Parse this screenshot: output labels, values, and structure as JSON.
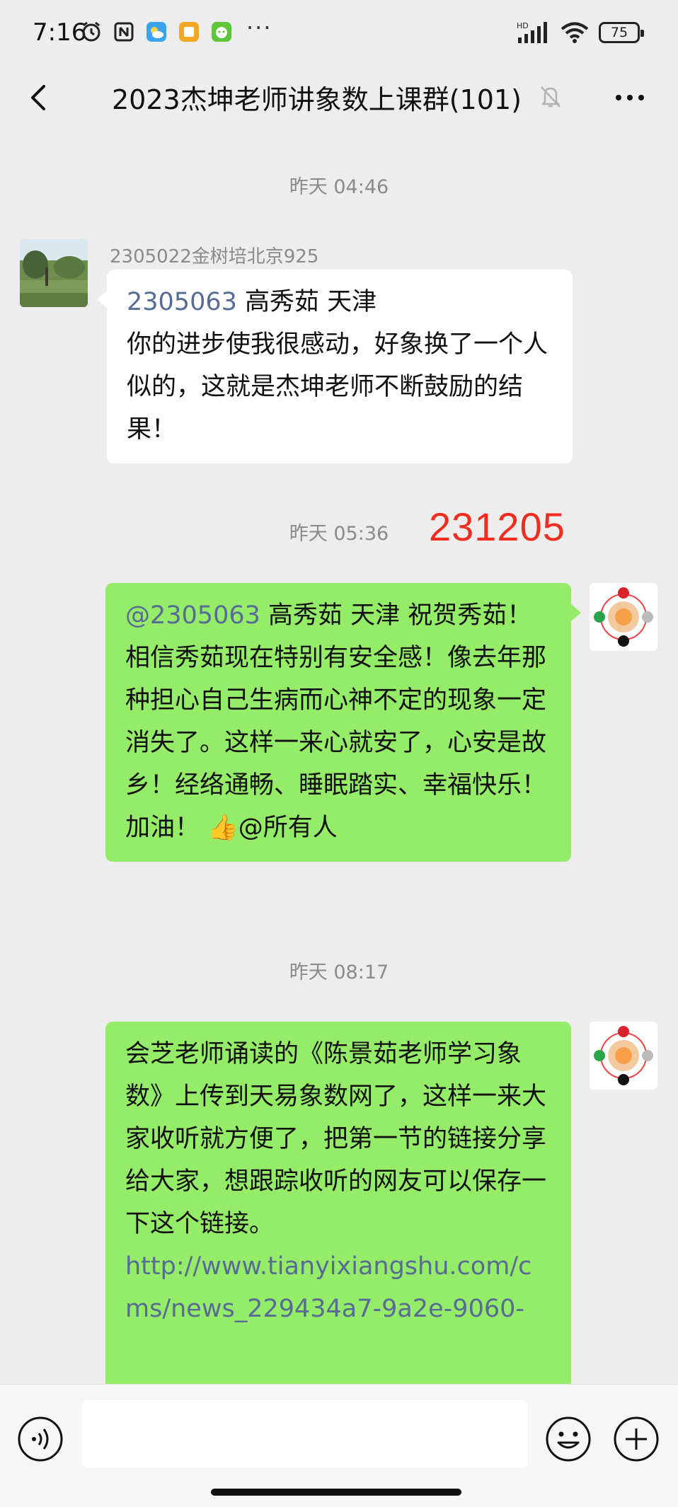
{
  "status_bar": {
    "time": "7:16",
    "dots": "···",
    "network": "HD",
    "battery": "75"
  },
  "header": {
    "title": "2023杰坤老师讲象数上课群(101)"
  },
  "messages": [
    {
      "timestamp": "昨天 04:46"
    },
    {
      "sender": "2305022金树培北京925",
      "mention": "2305063",
      "head": " 高秀茹  天津",
      "body": "你的进步使我很感动，好象换了一个人似的，这就是杰坤老师不断鼓励的结果！"
    },
    {
      "timestamp": "昨天 05:36",
      "annotation": "231205"
    },
    {
      "mention": "@2305063",
      "body": "  高秀茹  天津  祝贺秀茹！相信秀茹现在特别有安全感！像去年那种担心自己生病而心神不定的现象一定消失了。这样一来心就安了，心安是故乡！经络通畅、睡眠踏实、幸福快乐！加油！",
      "emoji": "👍",
      "tail": "@所有人"
    },
    {
      "timestamp": "昨天 08:17"
    },
    {
      "body": "会芝老师诵读的《陈景茹老师学习象数》上传到天易象数网了，这样一来大家收听就方便了，把第一节的链接分享给大家，想跟踪收听的网友可以保存一下这个链接。",
      "link": "http://www.tianyixiangshu.com/cms/news_229434a7-9a2e-9060-"
    }
  ],
  "input": {
    "placeholder": ""
  },
  "colors": {
    "background": "#ededed",
    "bubble_out": "#95ec69",
    "bubble_in": "#ffffff",
    "link": "#576b95",
    "annotation": "#f22c1e"
  }
}
